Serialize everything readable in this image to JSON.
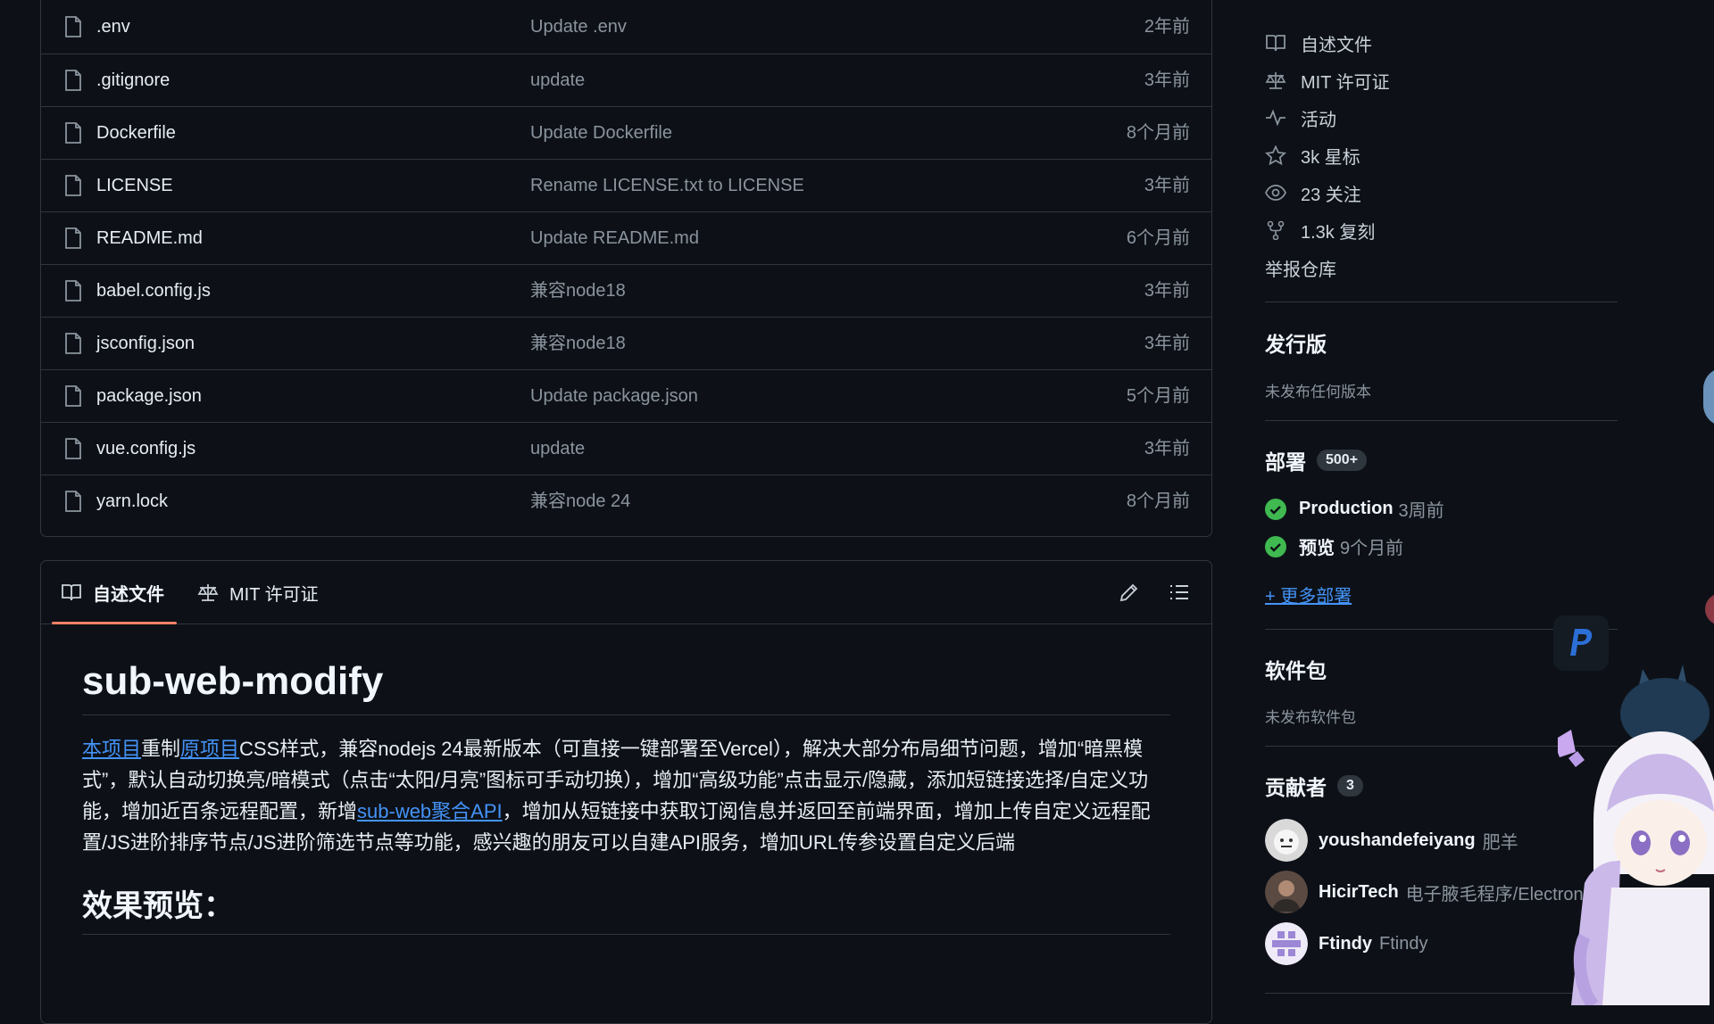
{
  "files": [
    {
      "name": ".env",
      "message": "Update .env",
      "age": "2年前"
    },
    {
      "name": ".gitignore",
      "message": "update",
      "age": "3年前"
    },
    {
      "name": "Dockerfile",
      "message": "Update Dockerfile",
      "age": "8个月前"
    },
    {
      "name": "LICENSE",
      "message": "Rename LICENSE.txt to LICENSE",
      "age": "3年前"
    },
    {
      "name": "README.md",
      "message": "Update README.md",
      "age": "6个月前"
    },
    {
      "name": "babel.config.js",
      "message": "兼容node18",
      "age": "3年前"
    },
    {
      "name": "jsconfig.json",
      "message": "兼容node18",
      "age": "3年前"
    },
    {
      "name": "package.json",
      "message": "Update package.json",
      "age": "5个月前"
    },
    {
      "name": "vue.config.js",
      "message": "update",
      "age": "3年前"
    },
    {
      "name": "yarn.lock",
      "message": "兼容node 24",
      "age": "8个月前"
    }
  ],
  "readme": {
    "tab_readme": "自述文件",
    "tab_license": "MIT 许可证",
    "title": "sub-web-modify",
    "link1": "本项目",
    "text1": "重制",
    "link2": "原项目",
    "text2": "CSS样式，兼容nodejs 24最新版本（可直接一键部署至Vercel），解决大部分布局细节问题，增加“暗黑模式”，默认自动切换亮/暗模式（点击“太阳/月亮”图标可手动切换），增加“高级功能”点击显示/隐藏，添加短链接选择/自定义功能，增加近百条远程配置，新增",
    "link3": "sub-web聚合API",
    "text3": "，增加从短链接中获取订阅信息并返回至前端界面，增加上传自定义远程配置/JS进阶排序节点/JS进阶筛选节点等功能，感兴趣的朋友可以自建API服务，增加URL传参设置自定义后端",
    "h2": "效果预览："
  },
  "sidebar": {
    "links": {
      "readme": "自述文件",
      "license": "MIT 许可证",
      "activity": "活动",
      "stars": "3k 星标",
      "watching": "23 关注",
      "forks": "1.3k 复刻",
      "report": "举报仓库"
    },
    "releases_title": "发行版",
    "releases_sub": "未发布任何版本",
    "deployments_title": "部署",
    "deployments_count": "500+",
    "deployments": [
      {
        "name": "Production",
        "time": "3周前"
      },
      {
        "name": "预览",
        "time": "9个月前"
      }
    ],
    "more_deployments": "+ 更多部署",
    "packages_title": "软件包",
    "packages_sub": "未发布软件包",
    "contributors_title": "贡献者",
    "contributors_count": "3",
    "contributors": [
      {
        "login": "youshandefeiyang",
        "name": "肥羊"
      },
      {
        "login": "HicirTech",
        "name": "电子腋毛程序/Electron"
      },
      {
        "login": "Ftindy",
        "name": "Ftindy"
      }
    ]
  },
  "colors": {
    "background": "#0d1117",
    "border": "#30363d",
    "link": "#4493f8",
    "success": "#3fb950",
    "tab_accent": "#f78166"
  }
}
